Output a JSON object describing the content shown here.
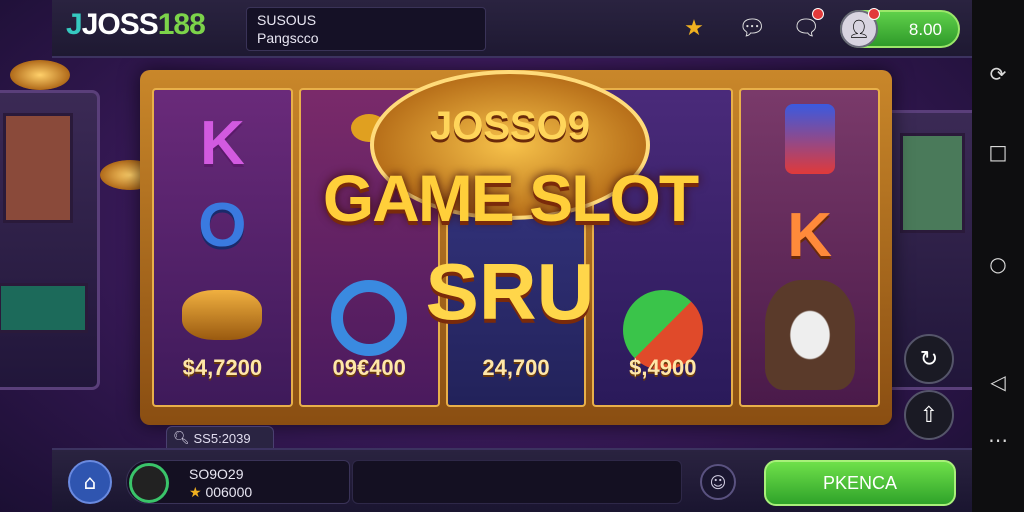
{
  "header": {
    "logo_j": "J",
    "logo_joss": "JOSS",
    "logo_num": "188",
    "username": "SUSOUS",
    "subtitle": "Pangscco",
    "balance": "8.00",
    "icons": [
      "star-icon",
      "chat-icon",
      "message-icon"
    ]
  },
  "game": {
    "title_top": "JOSSO9",
    "title_main": "GAME SLOT",
    "title_sub": "SRU",
    "reels": [
      {
        "symbol": "K",
        "symbol2": "O",
        "value": "$4,7200"
      },
      {
        "symbol": "",
        "value": "09€400"
      },
      {
        "symbol": "",
        "value": "24,700"
      },
      {
        "symbol": "",
        "value": "$,4900"
      },
      {
        "symbol": "K",
        "value": ""
      }
    ]
  },
  "search_tab": {
    "label": "SS5:2039"
  },
  "footer": {
    "player_id": "SO9O29",
    "player_score": "006000",
    "action_label": "PKENCA"
  },
  "colors": {
    "accent_green": "#5fd04a",
    "gold": "#ffcf3a",
    "frame": "#c9872a"
  }
}
